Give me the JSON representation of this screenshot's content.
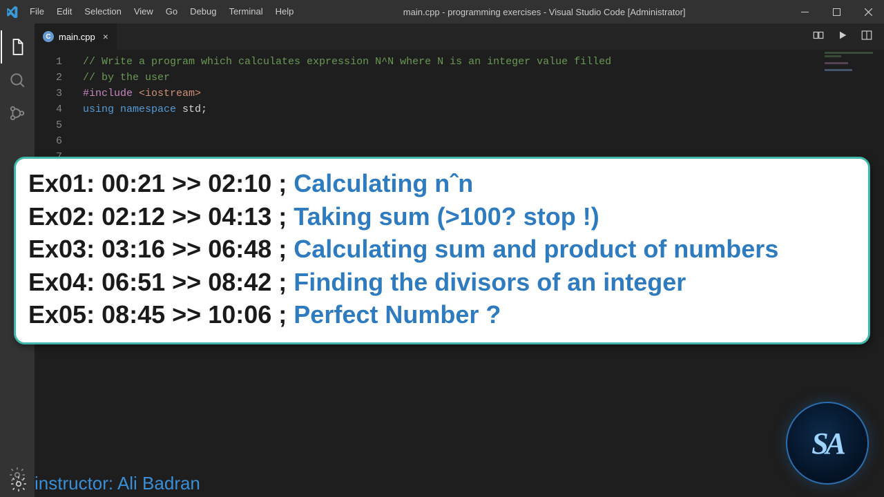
{
  "titlebar": {
    "menu": [
      "File",
      "Edit",
      "Selection",
      "View",
      "Go",
      "Debug",
      "Terminal",
      "Help"
    ],
    "title": "main.cpp - programming exercises - Visual Studio Code [Administrator]"
  },
  "tab": {
    "filename": "main.cpp"
  },
  "code": {
    "lines": [
      {
        "n": "1",
        "segs": [
          {
            "cls": "c-comment",
            "t": "// Write a program which calculates expression N^N where N is an integer value filled"
          }
        ]
      },
      {
        "n": "2",
        "segs": [
          {
            "cls": "c-comment",
            "t": "// by the user"
          }
        ]
      },
      {
        "n": "3",
        "segs": [
          {
            "cls": "c-ident",
            "t": ""
          }
        ]
      },
      {
        "n": "4",
        "segs": [
          {
            "cls": "c-macro",
            "t": "#include "
          },
          {
            "cls": "c-string",
            "t": "<iostream>"
          }
        ]
      },
      {
        "n": "5",
        "segs": [
          {
            "cls": "c-ident",
            "t": ""
          }
        ]
      },
      {
        "n": "6",
        "segs": [
          {
            "cls": "c-keyword",
            "t": "using "
          },
          {
            "cls": "c-keyword",
            "t": "namespace "
          },
          {
            "cls": "c-ident",
            "t": "std;"
          }
        ]
      },
      {
        "n": "7",
        "segs": [
          {
            "cls": "c-ident",
            "t": ""
          }
        ]
      }
    ]
  },
  "overlay": {
    "rows": [
      {
        "label": "Ex01:",
        "time": "00:21 >> 02:10 ; ",
        "title": "Calculating nˆn"
      },
      {
        "label": "Ex02:",
        "time": "02:12 >> 04:13 ; ",
        "title": "Taking sum (>100? stop !)"
      },
      {
        "label": "Ex03:",
        "time": "03:16 >> 06:48 ; ",
        "title": "Calculating sum and product of numbers"
      },
      {
        "label": "Ex04:",
        "time": "06:51 >> 08:42 ; ",
        "title": "Finding the divisors of an integer"
      },
      {
        "label": "Ex05:",
        "time": "08:45 >> 10:06 ; ",
        "title": "Perfect Number ?"
      }
    ]
  },
  "instructor": {
    "label": "instructor: ",
    "name": "Ali Badran"
  },
  "logo_badge": "SA"
}
